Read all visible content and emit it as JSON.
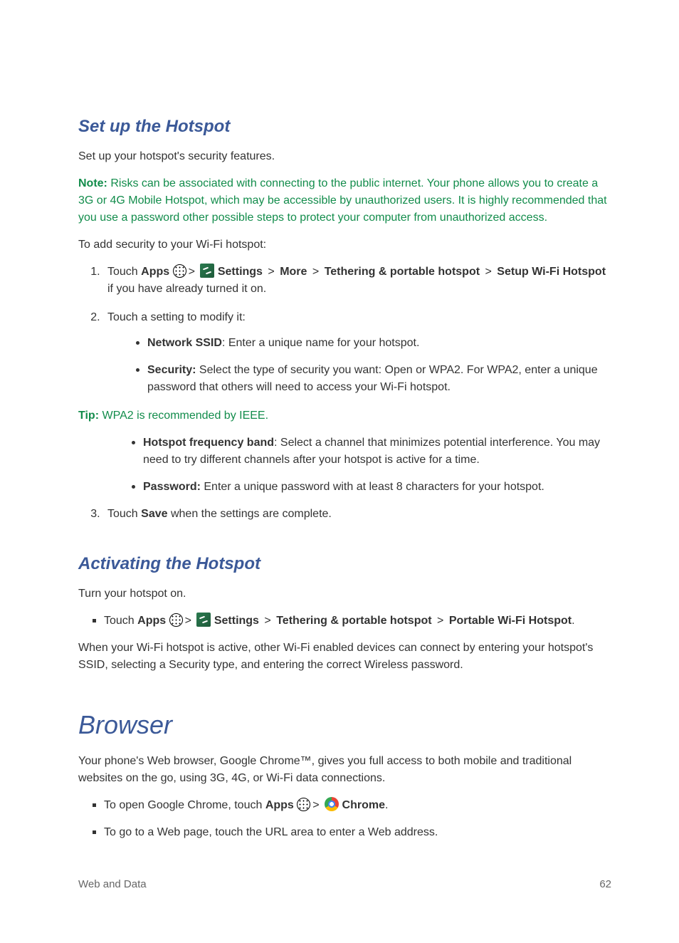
{
  "section1": {
    "title": "Set up the Hotspot",
    "intro": "Set up your hotspot's security features.",
    "noteLabel": "Note:",
    "noteText": " Risks can be associated with connecting to the public internet. Your phone allows you to create a 3G or 4G Mobile Hotspot, which may be accessible by unauthorized users. It is highly recommended that you use a password other possible steps to protect your computer from unauthorized access.",
    "addSecurity": "To add security to your Wi-Fi hotspot:",
    "step1": {
      "touch": "Touch ",
      "apps": "Apps",
      "settings": " Settings",
      "more": "More",
      "tethering": "Tethering & portable hotspot",
      "setup": "Setup Wi-Fi Hotspot",
      "tail": " if you have already turned it on."
    },
    "step2": {
      "lead": "Touch a setting to modify it:",
      "ssidLabel": "Network SSID",
      "ssidText": ": Enter a unique name for your hotspot.",
      "secLabel": "Security:",
      "secText": "  Select the type of security you want: Open or WPA2. For WPA2, enter a unique password that others will need to access your Wi-Fi hotspot."
    },
    "tipLabel": "Tip:",
    "tipText": "  WPA2 is recommended by IEEE.",
    "step2b": {
      "bandLabel": "Hotspot frequency band",
      "bandText": ": Select a channel that minimizes potential interference. You may need to try different channels after your hotspot is active for a time.",
      "pwLabel": "Password:",
      "pwText": "  Enter a unique password with at least 8 characters for your hotspot."
    },
    "step3": {
      "touch": "Touch ",
      "save": "Save",
      "tail": " when the settings are complete."
    }
  },
  "section2": {
    "title": "Activating the Hotspot",
    "intro": "Turn your hotspot on.",
    "step": {
      "touch": "Touch ",
      "apps": "Apps",
      "settings": " Settings",
      "tethering": "Tethering & portable hotspot",
      "portable": "Portable Wi-Fi Hotspot"
    },
    "when": "When your Wi-Fi hotspot is active, other Wi-Fi enabled devices can connect by entering your hotspot's SSID, selecting a Security type, and entering the correct Wireless password."
  },
  "section3": {
    "title": "Browser",
    "intro": "Your phone's Web browser, Google Chrome™, gives you full access to both mobile and traditional websites on the go, using 3G, 4G, or Wi-Fi data connections.",
    "open": {
      "lead": "To open Google Chrome, touch ",
      "apps": "Apps",
      "chrome": " Chrome"
    },
    "goto": "To go to a Web page, touch the URL area to enter a Web address."
  },
  "footer": {
    "left": "Web and Data",
    "right": "62"
  },
  "gt": ">"
}
